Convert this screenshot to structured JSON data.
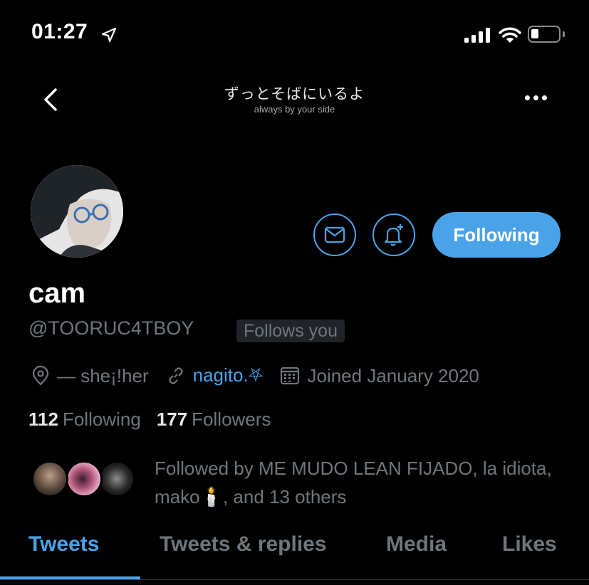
{
  "status_bar": {
    "time": "01:27"
  },
  "header": {
    "title_jp": "ずっとそばにいるよ",
    "subtitle": "always by your side"
  },
  "profile": {
    "name": "cam",
    "handle": "@TOORUC4TBOY",
    "follows_you": "Follows you",
    "location": "— she¡!her",
    "link": "nagito.⛧",
    "joined": "Joined January 2020",
    "following_count": "112",
    "following_label": "Following",
    "followers_count": "177",
    "followers_label": "Followers",
    "followed_by_prefix": "Followed by ME MUDO LEAN FIJADO, la idiota, mako",
    "followed_by_emoji": "🕯️",
    "followed_by_suffix": ", and 13 others"
  },
  "actions": {
    "follow_label": "Following"
  },
  "tabs": [
    {
      "label": "Tweets",
      "active": true
    },
    {
      "label": "Tweets & replies"
    },
    {
      "label": "Media"
    },
    {
      "label": "Likes"
    }
  ],
  "colors": {
    "accent": "#4aa3e8",
    "muted": "#6e767d",
    "background": "#000000"
  },
  "icons": [
    "location-arrow-icon",
    "signal-icon",
    "wifi-icon",
    "battery-icon",
    "back-chevron-icon",
    "more-icon",
    "mail-icon",
    "bell-plus-icon",
    "location-pin-icon",
    "link-icon",
    "calendar-icon"
  ]
}
